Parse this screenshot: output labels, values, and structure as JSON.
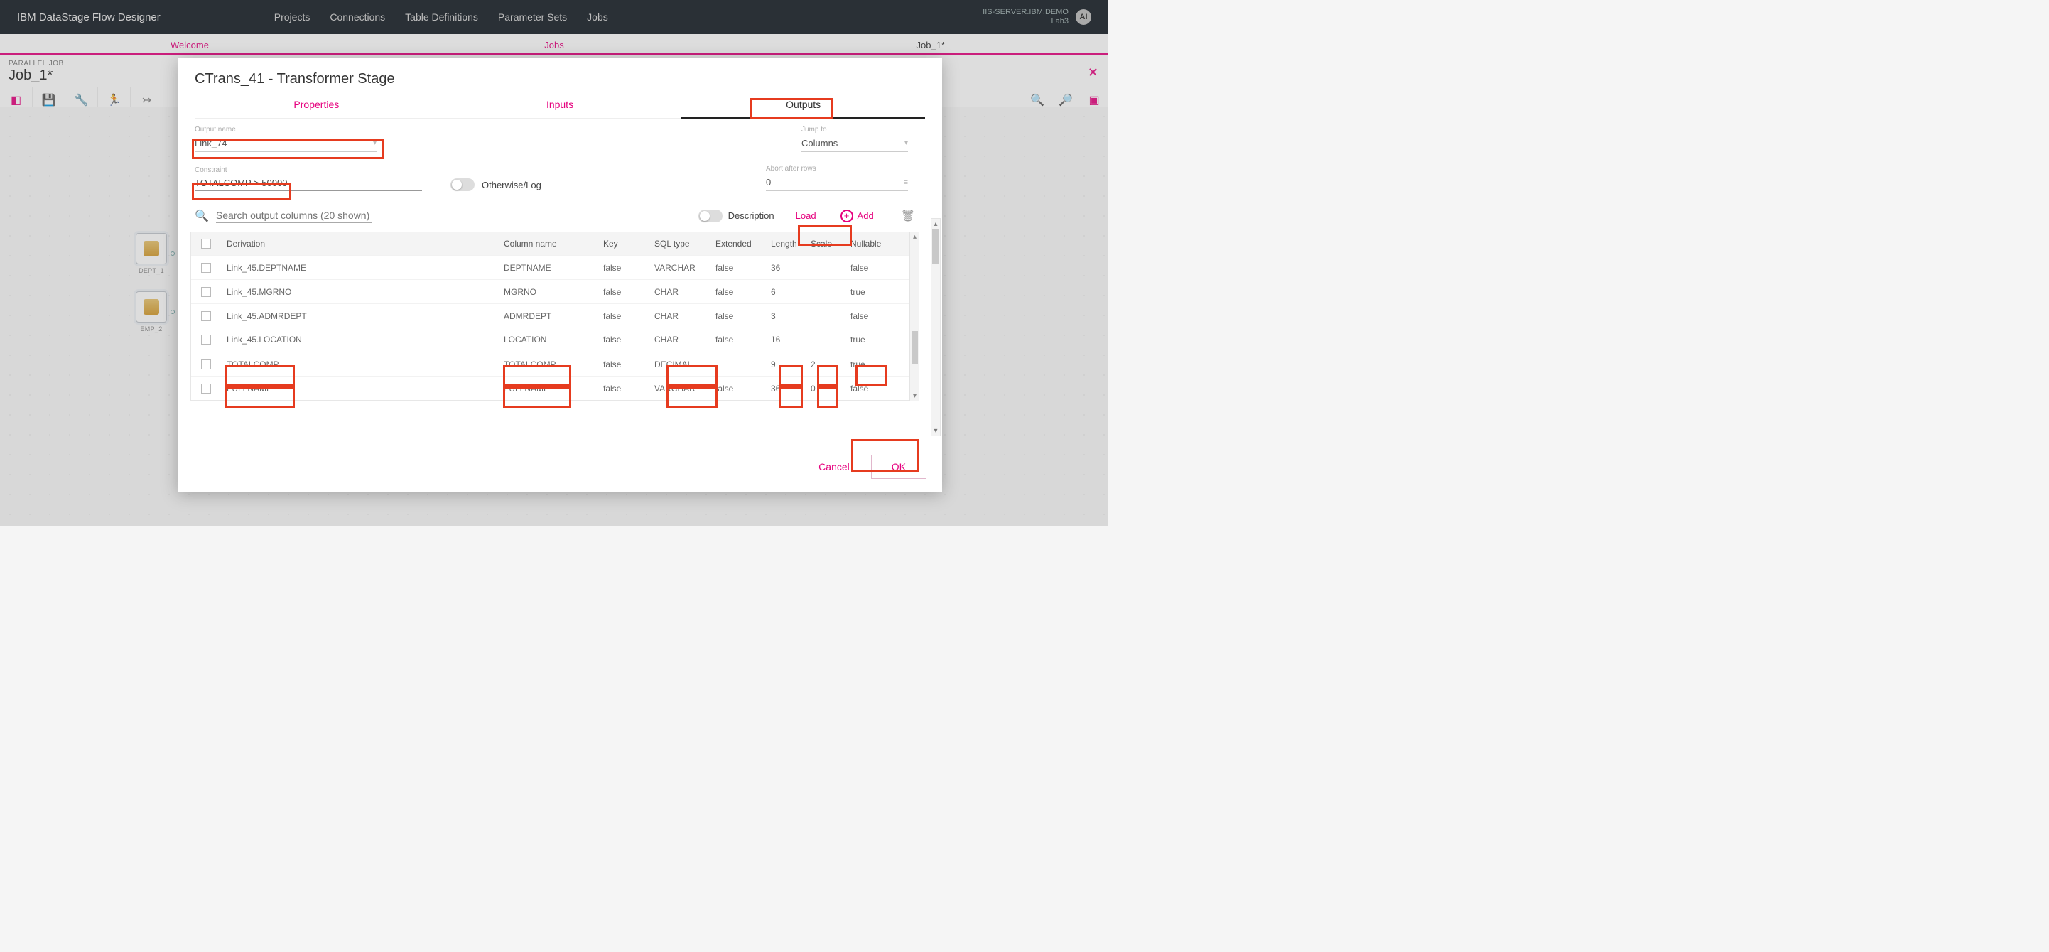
{
  "brand": "IBM DataStage Flow Designer",
  "nav": {
    "projects": "Projects",
    "connections": "Connections",
    "tabledefs": "Table Definitions",
    "paramsets": "Parameter Sets",
    "jobs": "Jobs"
  },
  "server": {
    "line1": "IIS-SERVER.IBM.DEMO",
    "line2": "Lab3"
  },
  "avatar": "AI",
  "tabs": {
    "welcome": "Welcome",
    "jobs": "Jobs",
    "job1": "Job_1*"
  },
  "job": {
    "type": "PARALLEL JOB",
    "name": "Job_1*"
  },
  "nodes": {
    "dept": "DEPT_1",
    "emp": "EMP_2"
  },
  "dialog": {
    "title": "CTrans_41 - Transformer Stage",
    "tabs": {
      "properties": "Properties",
      "inputs": "Inputs",
      "outputs": "Outputs"
    },
    "outputname_label": "Output name",
    "outputname_value": "Link_74",
    "jumpto_label": "Jump to",
    "jumpto_value": "Columns",
    "constraint_label": "Constraint",
    "constraint_value": "TOTALCOMP > 50000",
    "otherwise_label": "Otherwise/Log",
    "abort_label": "Abort after rows",
    "abort_value": "0",
    "search_placeholder": "Search output columns (20 shown)",
    "description_label": "Description",
    "load_label": "Load",
    "add_label": "Add",
    "headers": {
      "derivation": "Derivation",
      "col": "Column name",
      "key": "Key",
      "sql": "SQL type",
      "ext": "Extended",
      "len": "Length",
      "scl": "Scale",
      "nul": "Nullable"
    },
    "rows": [
      {
        "der": "Link_45.DEPTNAME",
        "col": "DEPTNAME",
        "key": "false",
        "sql": "VARCHAR",
        "ext": "false",
        "len": "36",
        "scl": "",
        "nul": "false"
      },
      {
        "der": "Link_45.MGRNO",
        "col": "MGRNO",
        "key": "false",
        "sql": "CHAR",
        "ext": "false",
        "len": "6",
        "scl": "",
        "nul": "true"
      },
      {
        "der": "Link_45.ADMRDEPT",
        "col": "ADMRDEPT",
        "key": "false",
        "sql": "CHAR",
        "ext": "false",
        "len": "3",
        "scl": "",
        "nul": "false"
      },
      {
        "der": "Link_45.LOCATION",
        "col": "LOCATION",
        "key": "false",
        "sql": "CHAR",
        "ext": "false",
        "len": "16",
        "scl": "",
        "nul": "true"
      },
      {
        "der": "TOTALCOMP",
        "col": "TOTALCOMP",
        "key": "false",
        "sql": "DECIMAL",
        "ext": "",
        "len": "9",
        "scl": "2",
        "nul": "true"
      },
      {
        "der": "FULLNAME",
        "col": "FULLNAME",
        "key": "false",
        "sql": "VARCHAR",
        "ext": "false",
        "len": "36",
        "scl": "0",
        "nul": "false"
      }
    ],
    "cancel": "Cancel",
    "ok": "OK"
  }
}
